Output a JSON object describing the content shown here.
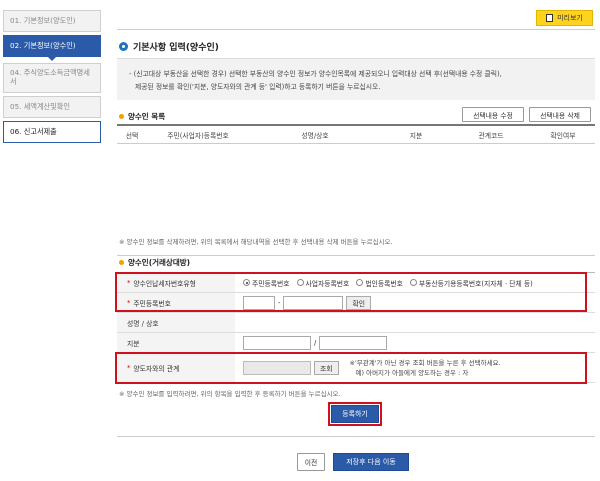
{
  "sidebar": {
    "steps": [
      {
        "label": "01. 기본정보(양도인)"
      },
      {
        "label": "02. 기본정보(양수인)"
      },
      {
        "label": "04. 주식양도소득금액명세서"
      },
      {
        "label": "05. 세액계산및확인"
      },
      {
        "label": "06. 신고서제출"
      }
    ]
  },
  "header": {
    "preview_label": "미리보기"
  },
  "section": {
    "title": "기본사항 입력(양수인)",
    "notice_line1": "- (신고대상 부동산을 선택한 경우) 선택한 부동산의 양수인 정보가 양수인목록에 제공되오니 입력대상 선택 후(선택내용 수정 클릭),",
    "notice_line2": "제공된 정보를 확인('지분, 양도자와의 관계 등' 입력)하고 등록하기 버튼을 누르십시오."
  },
  "list": {
    "title": "양수인 목록",
    "edit_button": "선택내용 수정",
    "delete_button": "선택내용 삭제",
    "columns": [
      "선택",
      "주민(사업자)등록번호",
      "성명/상호",
      "지분",
      "관계코드",
      "확인여부"
    ],
    "hint": "※ 양수인 정보를 삭제하려면, 위의 목록에서 해당내역을 선택한 후 선택내용 삭제 버튼을 누르십시오."
  },
  "form": {
    "title": "양수인(거래상대방)",
    "id_type_label": "양수인납세자번호유형",
    "id_type_options": [
      "주민등록번호",
      "사업자등록번호",
      "법인등록번호",
      "부동산등기용등록번호(지자체 · 단체 등)"
    ],
    "id_type_selected": 0,
    "rrn_label": "주민등록번호",
    "rrn_dash": "-",
    "confirm_button": "확인",
    "name_label": "성명 / 상호",
    "share_label": "지분",
    "share_slash": "/",
    "relation_label": "양도자와의 관계",
    "relation_button": "조회",
    "relation_note1": "※'무관계'가 아닌 경우 조회 버튼을 누른 후 선택하세요.",
    "relation_note2": "예) 아버지가 아들에게 양도하는 경우 : 자",
    "required_mark": "*",
    "hint": "※ 양수인 정보를 입력하려면, 위의 항목을 입력한 후 등록하기 버튼을 누르십시오."
  },
  "actions": {
    "register": "등록하기",
    "prev": "이전",
    "save_next": "저장후 다음 이동"
  },
  "colors": {
    "accent": "#2a5aa8",
    "highlight": "#d0101e",
    "preview": "#ffd21e"
  }
}
